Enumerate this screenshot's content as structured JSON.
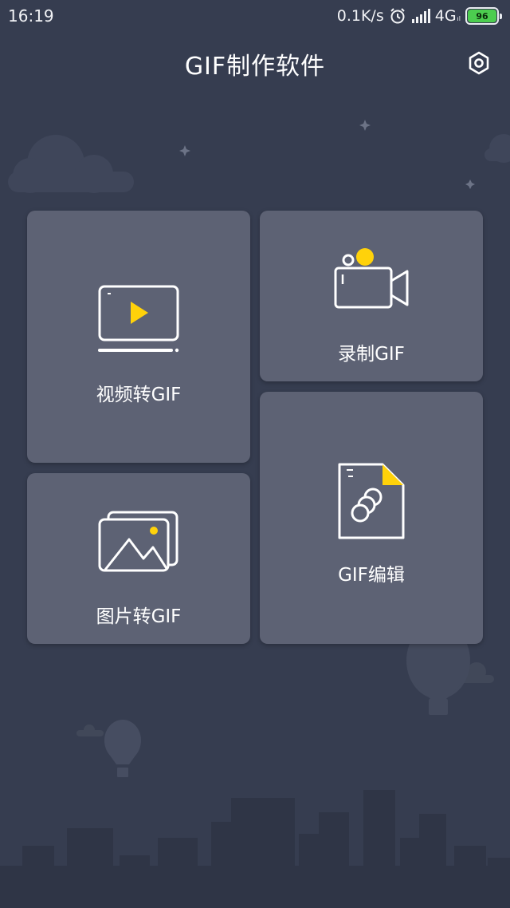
{
  "status_bar": {
    "time": "16:19",
    "speed": "0.1K/s",
    "network": "4G",
    "network_sub": "ıl",
    "battery": "96"
  },
  "header": {
    "title": "GIF制作软件",
    "settings_icon": "gear-icon"
  },
  "tiles": {
    "video_to_gif": {
      "label": "视频转GIF",
      "icon": "video-player-icon"
    },
    "record_gif": {
      "label": "录制GIF",
      "icon": "video-camera-icon"
    },
    "image_to_gif": {
      "label": "图片转GIF",
      "icon": "photo-stack-icon"
    },
    "gif_edit": {
      "label": "GIF编辑",
      "icon": "gif-file-icon"
    }
  },
  "colors": {
    "background": "#363d50",
    "card": "#5d6274",
    "accent": "#ffd20a",
    "battery": "#4ccd4f"
  }
}
